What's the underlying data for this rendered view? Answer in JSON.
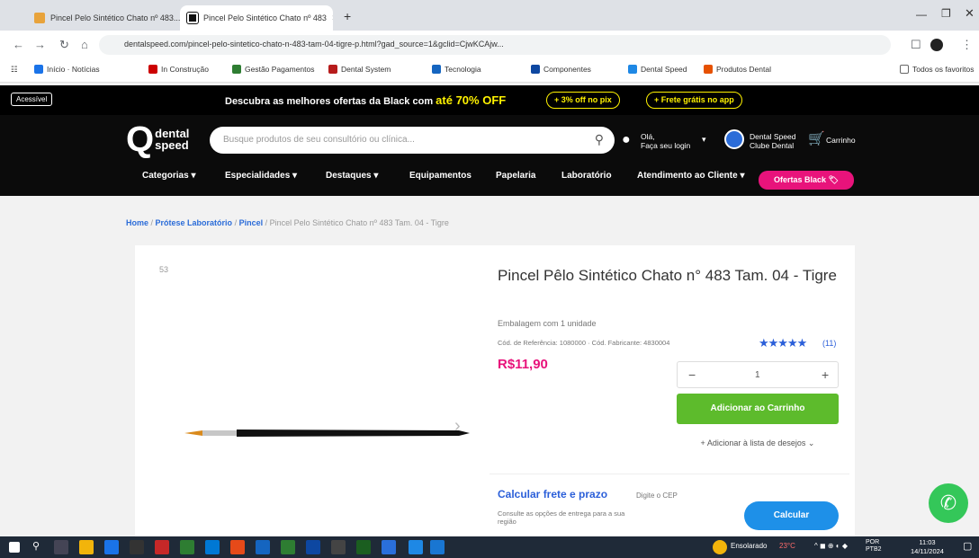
{
  "browser": {
    "tabs": [
      {
        "label": "Pincel Pelo Sintético Chato nº 483...",
        "active": false
      },
      {
        "label": "Pincel Pelo Sintético Chato nº 483",
        "active": true
      }
    ],
    "new_tab": "+",
    "url": "dentalspeed.com/pincel-pelo-sintetico-chato-n-483-tam-04-tigre-p.html?gad_source=1&gclid=CjwKCAjw...",
    "bookmarks": [
      "Início · Notícias",
      "In Construção",
      "Gestão Pagamentos",
      "Dental System",
      "Tecnologia",
      "Componentes",
      "Dental Speed",
      "Produtos Dental",
      "Todos os favoritos"
    ]
  },
  "site": {
    "accessibility_label": "Acessível",
    "promo_prefix": "Descubra as melhores ofertas da Black com",
    "promo_highlight": "até 70% OFF",
    "promo_pill_1": "+ 3% off no pix",
    "promo_pill_2": "+ Frete grátis no app",
    "logo_q": "Q",
    "logo_line1": "dental",
    "logo_line2": "speed",
    "search_placeholder": "Busque produtos de seu consultório ou clínica...",
    "account_line1": "Olá,",
    "account_line2": "Faça seu login",
    "club_line1": "Dental Speed",
    "club_line2": "Clube Dental",
    "cart_label": "Carrinho",
    "nav": [
      "Categorias",
      "Especialidades",
      "Destaques",
      "Equipamentos",
      "Papelaria",
      "Laboratório",
      "Atendimento ao Cliente"
    ],
    "nav_promo": "Ofertas Black"
  },
  "breadcrumb": {
    "home": "Home",
    "cat": "Prótese Laboratório",
    "sub": "Pincel",
    "current": "Pincel Pelo Sintético Chato nº 483 Tam. 04 - Tigre"
  },
  "product": {
    "image_badge": "53",
    "title": "Pincel Pêlo Sintético Chato n° 483 Tam. 04 - Tigre",
    "packaging": "Embalagem com 1 unidade",
    "codes": "Cód. de Referência: 1080000  ·  Cód. Fabricante: 4830004",
    "rating_stars": "★★★★★",
    "rating_count": "(11)",
    "price": "R$11,90",
    "qty_minus": "−",
    "qty_value": "1",
    "qty_plus": "+",
    "add_to_cart": "Adicionar ao Carrinho",
    "wishlist": "Adicionar à lista de desejos",
    "shipping_title": "Calcular frete e prazo",
    "shipping_sub": "Consulte as opções de entrega para a sua região",
    "cep_placeholder": "Digite o CEP",
    "calc_button": "Calcular"
  },
  "taskbar": {
    "weather": "Ensolarado",
    "temp": "23°C",
    "time": "11:03",
    "date": "14/11/2024",
    "lang": "POR PTB2"
  }
}
